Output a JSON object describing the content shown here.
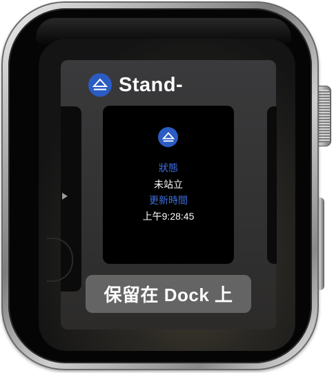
{
  "app": {
    "title": "Stand-",
    "icon": "stand-eject-icon",
    "accent_color": "#2b5cc4"
  },
  "card": {
    "status_label": "狀態",
    "status_value": "未站立",
    "updated_label": "更新時間",
    "updated_value": "上午9:28:45",
    "label_color": "#3d6fe0"
  },
  "dock": {
    "keep_button_label": "保留在 Dock 上"
  }
}
